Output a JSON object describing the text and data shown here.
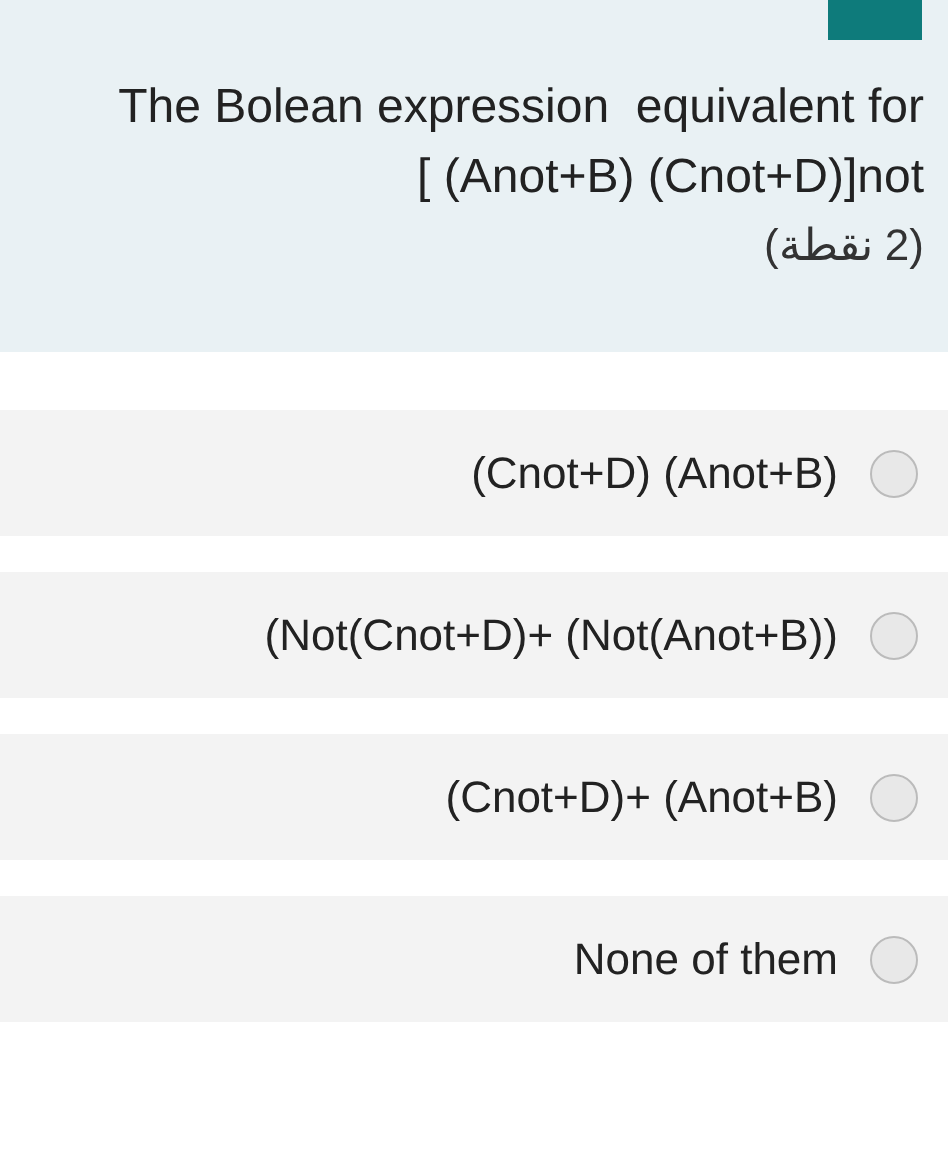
{
  "question": {
    "text": "The Bolean expression  equivalent for\n[ (Anot+B) (Cnot+D)]not",
    "points": "(2 نقطة)"
  },
  "options": [
    {
      "label": "(Cnot+D) (Anot+B)",
      "selected": false
    },
    {
      "label": "(Not(Cnot+D)+ (Not(Anot+B))",
      "selected": false
    },
    {
      "label": "(Cnot+D)+ (Anot+B)",
      "selected": false
    },
    {
      "label": "None of them",
      "selected": false
    }
  ]
}
